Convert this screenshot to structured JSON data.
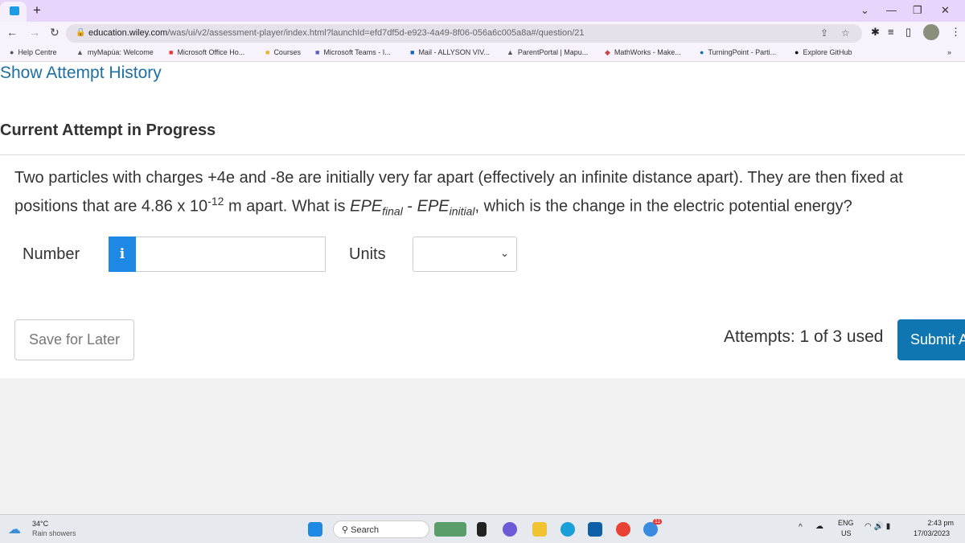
{
  "browser": {
    "new_tab": "+",
    "url_domain": "education.wiley.com",
    "url_path": "/was/ui/v2/assessment-player/index.html?launchId=efd7df5d-e923-4a49-8f06-056a6c005a8a#/question/21",
    "bookmarks": [
      "Help Centre",
      "myMapúa: Welcome",
      "Microsoft Office Ho...",
      "Courses",
      "Microsoft Teams - I...",
      "Mail - ALLYSON VIV...",
      "ParentPortal | Mapu...",
      "MathWorks - Make...",
      "TurningPoint - Parti...",
      "Explore GitHub"
    ],
    "more": "»"
  },
  "page": {
    "history_link": "Show Attempt History",
    "section_title": "Current Attempt in Progress",
    "question": {
      "part1": "Two particles with charges +4e and -8e are initially very far apart (effectively an infinite distance apart). They are then fixed at positions that are 4.86 x 10",
      "exp": "-12",
      "part2": " m apart. What is ",
      "epe": "EPE",
      "final": "final",
      "minus": " - ",
      "initial": "initial",
      "part3": ", which is the change in the electric potential energy?"
    },
    "number_label": "Number",
    "number_value": "",
    "units_label": "Units",
    "units_value": "",
    "save_label": "Save for Later",
    "attempts": "Attempts: 1 of 3 used",
    "submit_label": "Submit Answer",
    "accent": "#0f76b2"
  },
  "taskbar": {
    "temp": "34°C",
    "weather": "Rain showers",
    "search": "Search",
    "lang1": "ENG",
    "lang2": "US",
    "time": "2:43 pm",
    "date": "17/03/2023",
    "badge": "11"
  }
}
